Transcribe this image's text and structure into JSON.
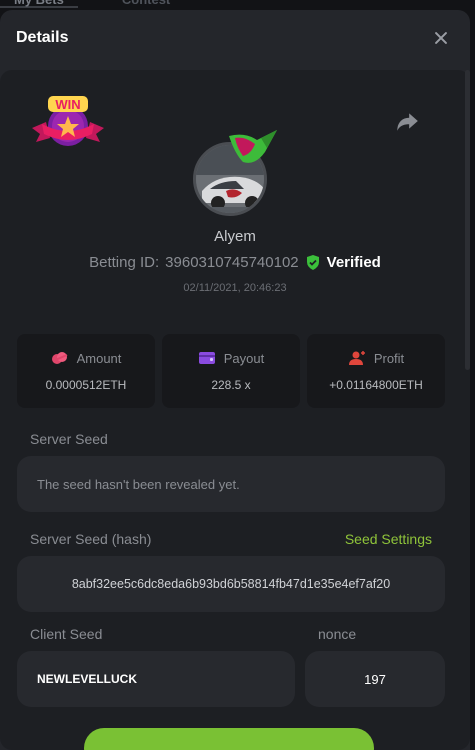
{
  "background_tabs": [
    "My Bets",
    "Contest"
  ],
  "modal": {
    "title": "Details"
  },
  "player": {
    "name": "Alyem",
    "betting_id_label": "Betting ID:",
    "betting_id": "3960310745740102",
    "verified_label": "Verified",
    "datetime": "02/11/2021, 20:46:23"
  },
  "stats": [
    {
      "label": "Amount",
      "value": "0.0000512ETH",
      "icon": "coins-icon",
      "color": "#e0466b"
    },
    {
      "label": "Payout",
      "value": "228.5 x",
      "icon": "wallet-icon",
      "color": "#8a4be0"
    },
    {
      "label": "Profit",
      "value": "+0.01164800ETH",
      "icon": "user-profit-icon",
      "color": "#e0463c"
    }
  ],
  "server_seed": {
    "label": "Server Seed",
    "value": "The seed hasn't been revealed yet."
  },
  "server_seed_hash": {
    "label": "Server Seed (hash)",
    "link": "Seed Settings",
    "value": "8abf32ee5c6dc8eda6b93bd6b58814fb47d1e35e4ef7af20"
  },
  "client_seed": {
    "label": "Client Seed",
    "value": "NEWLEVELLUCK"
  },
  "nonce": {
    "label": "nonce",
    "value": "197"
  },
  "colors": {
    "accent_green": "#8fc43a",
    "verified_green": "#3bbf3b"
  }
}
